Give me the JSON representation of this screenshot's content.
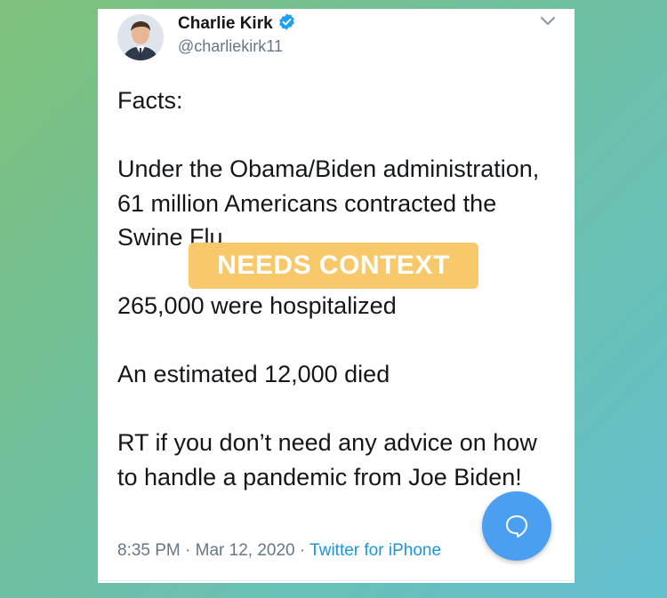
{
  "tweet": {
    "display_name": "Charlie Kirk",
    "handle": "@charliekirk11",
    "verified": true,
    "paragraphs": [
      "Facts:",
      "Under the Obama/Biden administration, 61 million Americans contracted the Swine Flu",
      "265,000 were hospitalized",
      "An estimated 12,000 died",
      "RT if you don’t need any advice on how to handle a pandemic from Joe Biden!"
    ],
    "time": "8:35 PM",
    "date": "Mar 12, 2020",
    "separator": "·",
    "source": "Twitter for iPhone"
  },
  "overlay": {
    "label": "NEEDS CONTEXT"
  },
  "icons": {
    "verified": "verified-badge-icon",
    "chevron": "chevron-down-icon",
    "fab": "speech-bubble-icon"
  },
  "colors": {
    "verified_blue": "#1da1f2",
    "link_blue": "#1b95e0",
    "label_bg": "#f7c96b",
    "fab_bg": "#4a9ff0"
  }
}
